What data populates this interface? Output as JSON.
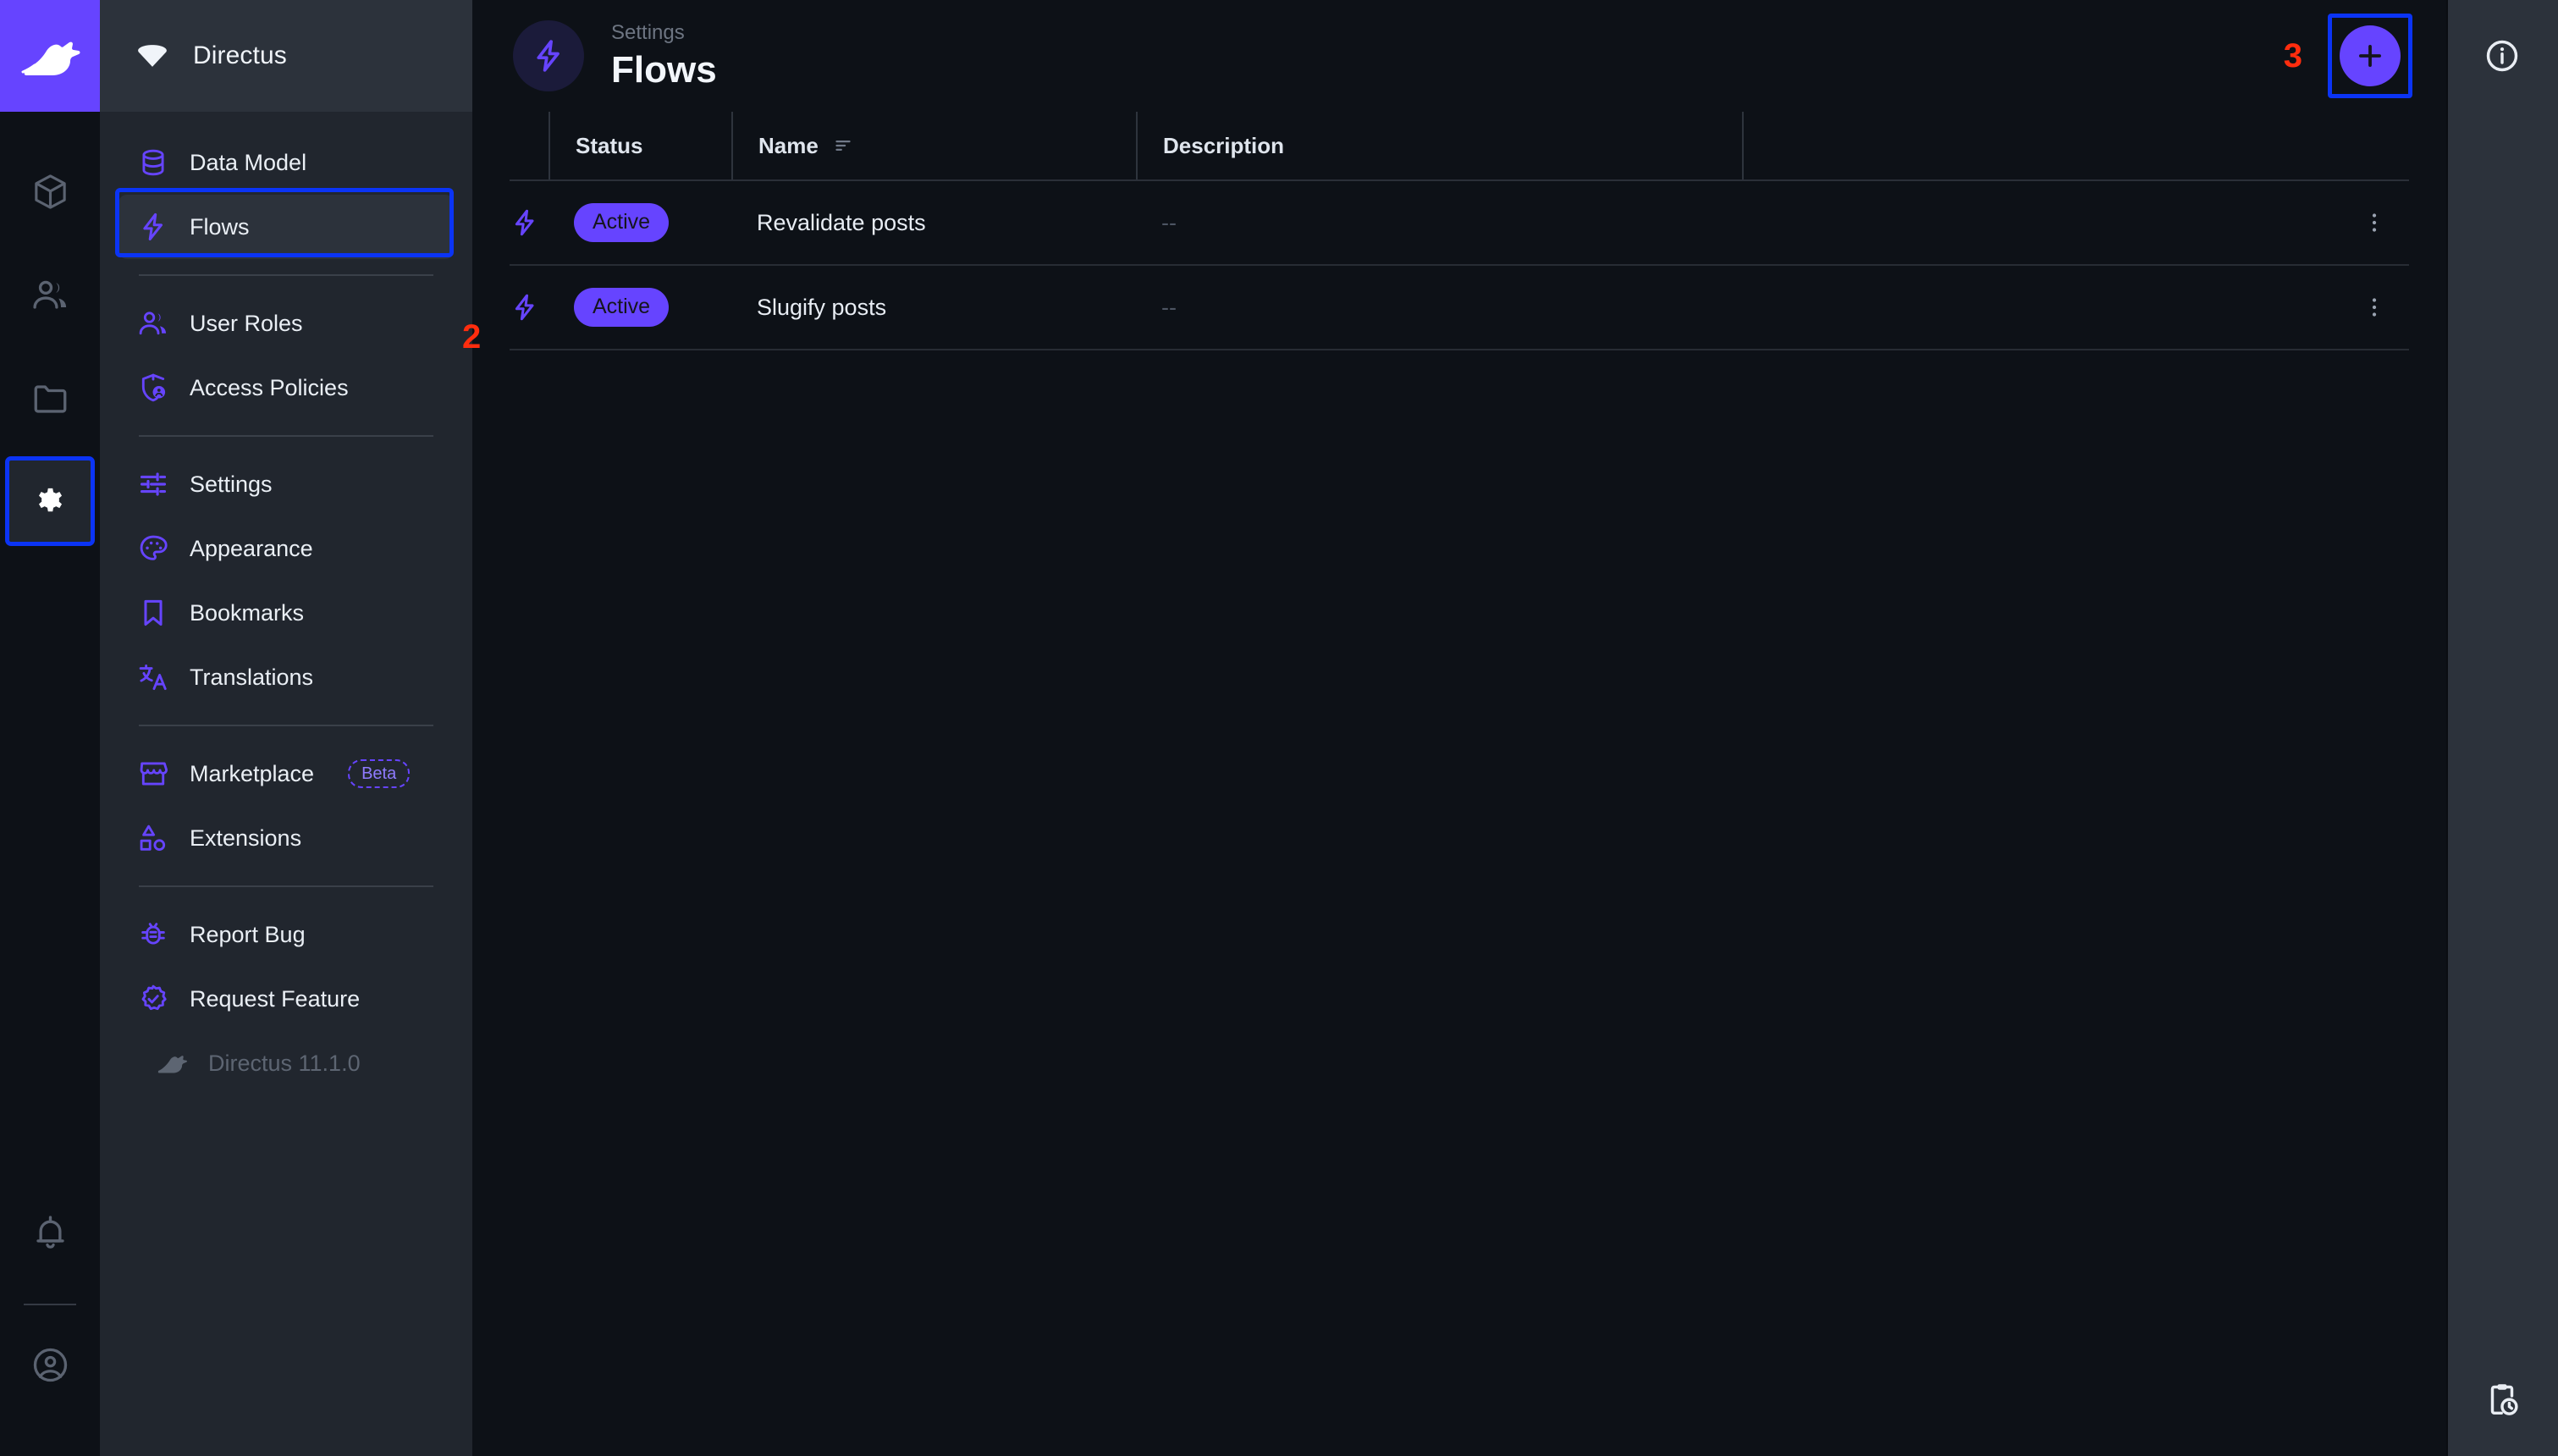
{
  "app": {
    "brand_name": "Directus",
    "version_label": "Directus 11.1.0"
  },
  "rail": {
    "items": [
      {
        "name": "content",
        "icon": "cube-icon",
        "active": false
      },
      {
        "name": "users",
        "icon": "people-icon",
        "active": false
      },
      {
        "name": "files",
        "icon": "folder-icon",
        "active": false
      },
      {
        "name": "settings",
        "icon": "gear-icon",
        "active": true
      }
    ],
    "bottom": [
      {
        "name": "notifications",
        "icon": "bell-icon"
      },
      {
        "name": "account",
        "icon": "account-circle-icon"
      }
    ]
  },
  "sidebar": {
    "groups": [
      {
        "items": [
          {
            "label": "Data Model",
            "icon": "database-icon",
            "active": false
          },
          {
            "label": "Flows",
            "icon": "bolt-icon",
            "active": true
          }
        ]
      },
      {
        "items": [
          {
            "label": "User Roles",
            "icon": "people-icon",
            "active": false
          },
          {
            "label": "Access Policies",
            "icon": "shield-person-icon",
            "active": false
          }
        ]
      },
      {
        "items": [
          {
            "label": "Settings",
            "icon": "tune-icon",
            "active": false
          },
          {
            "label": "Appearance",
            "icon": "palette-icon",
            "active": false
          },
          {
            "label": "Bookmarks",
            "icon": "bookmark-icon",
            "active": false
          },
          {
            "label": "Translations",
            "icon": "translate-icon",
            "active": false
          }
        ]
      },
      {
        "items": [
          {
            "label": "Marketplace",
            "icon": "storefront-icon",
            "active": false,
            "badge": "Beta"
          },
          {
            "label": "Extensions",
            "icon": "shapes-icon",
            "active": false
          }
        ]
      },
      {
        "items": [
          {
            "label": "Report Bug",
            "icon": "bug-icon",
            "active": false
          },
          {
            "label": "Request Feature",
            "icon": "verified-icon",
            "active": false
          }
        ]
      }
    ]
  },
  "header": {
    "breadcrumb": "Settings",
    "title": "Flows",
    "icon": "bolt-icon",
    "add_button_label": "+",
    "marker_3": "3"
  },
  "table": {
    "marker_2": "2",
    "columns": [
      {
        "key": "status",
        "label": "Status"
      },
      {
        "key": "name",
        "label": "Name",
        "sorted": true
      },
      {
        "key": "description",
        "label": "Description"
      }
    ],
    "rows": [
      {
        "icon": "bolt-icon",
        "status": "Active",
        "name": "Revalidate posts",
        "description": "--"
      },
      {
        "icon": "bolt-icon",
        "status": "Active",
        "name": "Slugify posts",
        "description": "--"
      }
    ],
    "row_menu_icon": "more-vertical-icon"
  },
  "rightbar": {
    "top": {
      "name": "info",
      "icon": "info-circle-icon"
    },
    "bottom": {
      "name": "activity-log",
      "icon": "clipboard-clock-icon"
    }
  },
  "colors": {
    "accent": "#6644ff",
    "highlight_outline": "#0b34f5",
    "marker_red": "#ff2d0e",
    "bg_main": "#0d1117",
    "bg_sidebar": "#21262e",
    "bg_panel": "#2c323b"
  }
}
